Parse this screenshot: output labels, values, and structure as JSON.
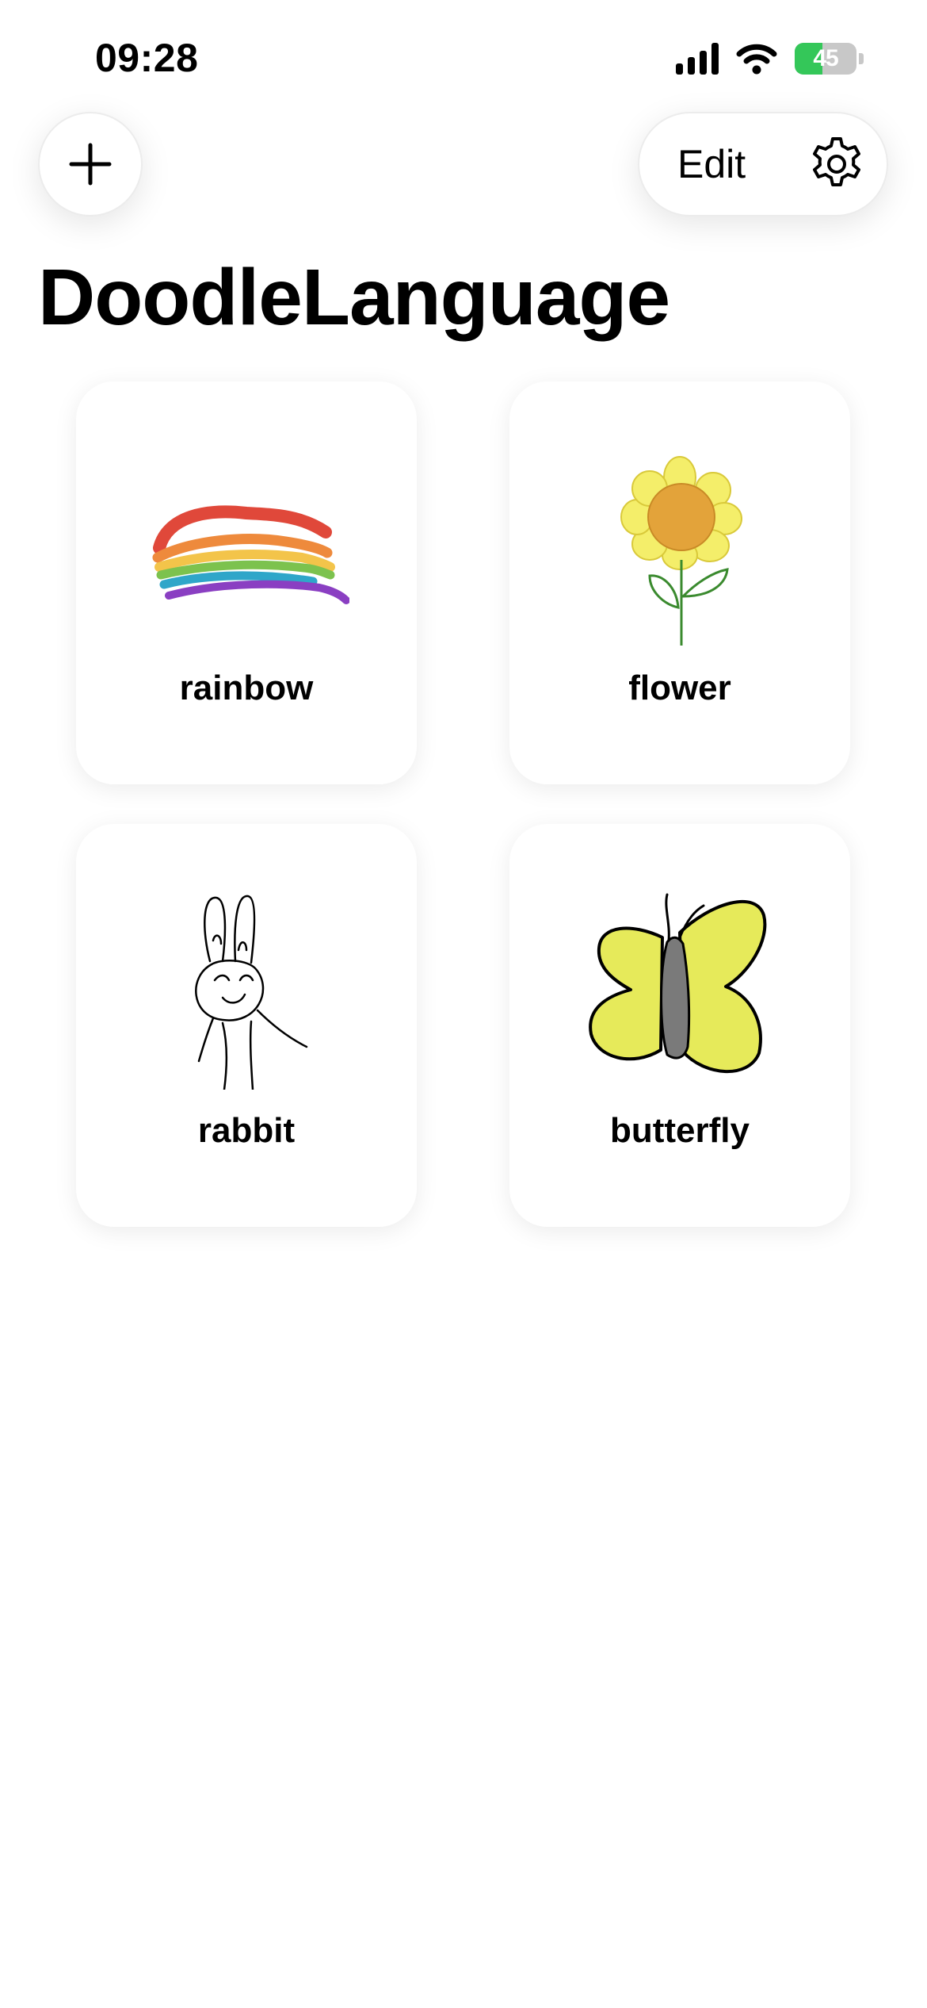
{
  "status_bar": {
    "time": "09:28",
    "battery_level": "45",
    "battery_percent_value": 45,
    "icons": [
      "cellular-signal-icon",
      "wifi-icon",
      "battery-charging-icon"
    ]
  },
  "toolbar": {
    "add_icon": "plus-icon",
    "edit_label": "Edit",
    "settings_icon": "gear-icon"
  },
  "page": {
    "title": "DoodleLanguage"
  },
  "doodles": [
    {
      "label": "rainbow",
      "icon": "rainbow-doodle"
    },
    {
      "label": "flower",
      "icon": "sunflower-doodle"
    },
    {
      "label": "rabbit",
      "icon": "rabbit-doodle"
    },
    {
      "label": "butterfly",
      "icon": "butterfly-doodle"
    }
  ],
  "colors": {
    "background": "#ffffff",
    "battery_green": "#34c759",
    "rainbow": [
      "#e0483a",
      "#ee8a3c",
      "#f3c44a",
      "#7cc24e",
      "#2fa6c9",
      "#8a3fc2"
    ],
    "flower_petal": "#f4ee6a",
    "flower_center": "#e3a33a",
    "flower_stem": "#3a8a2e",
    "butterfly_wing": "#e6ea5a",
    "butterfly_body": "#7a7a7a"
  }
}
